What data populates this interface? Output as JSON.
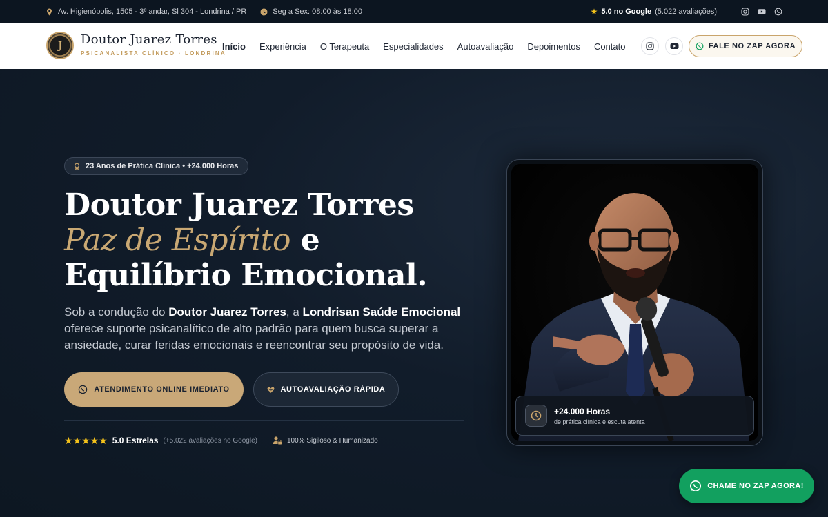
{
  "topbar": {
    "address": "Av. Higienópolis, 1505 - 3º andar, Sl 304 - Londrina / PR",
    "hours": "Seg a Sex: 08:00 às 18:00",
    "rating_bold": "5.0 no Google",
    "rating_count": "(5.022 avaliações)"
  },
  "header": {
    "logo_monogram": "J",
    "brand_name": "Doutor Juarez Torres",
    "brand_sub": "PSICANALISTA CLÍNICO · LONDRINA",
    "nav": [
      "Início",
      "Experiência",
      "O Terapeuta",
      "Especialidades",
      "Autoavaliação",
      "Depoimentos",
      "Contato"
    ],
    "cta": "FALE NO ZAP AGORA"
  },
  "hero": {
    "badge": "23 Anos de Prática Clínica • +24.000 Horas",
    "title_line1": "Doutor Juarez Torres",
    "title_italic": "Paz de Espírito",
    "title_e": " e",
    "title_line3": "Equilíbrio Emocional.",
    "lead_1": "Sob a condução do ",
    "lead_bold1": "Doutor Juarez Torres",
    "lead_2": ", a ",
    "lead_bold2": "Londrisan Saúde Emocional",
    "lead_3": " oferece suporte psicanalítico de alto padrão para quem busca superar a ansiedade, curar feridas emocionais e reencontrar seu propósito de vida.",
    "cta_primary": "ATENDIMENTO ONLINE IMEDIATO",
    "cta_secondary": "AUTOAVALIAÇÃO RÁPIDA",
    "stars": "★★★★★",
    "rating_label": "5.0 Estrelas",
    "rating_note": "(+5.022 avaliações no Google)",
    "secure_label": "100% Sigiloso & Humanizado"
  },
  "photo_card": {
    "stat_title": "+24.000 Horas",
    "stat_sub": "de prática clínica e escuta atenta"
  },
  "floating": {
    "label": "CHAME NO ZAP AGORA!"
  },
  "colors": {
    "gold": "#c9a878",
    "navy": "#0f1a28",
    "whatsapp_green": "#12a05f"
  },
  "icons": [
    "map-pin-icon",
    "clock-icon",
    "star-icon",
    "instagram-icon",
    "youtube-icon",
    "whatsapp-icon",
    "award-icon",
    "heart-icon",
    "user-lock-icon"
  ]
}
